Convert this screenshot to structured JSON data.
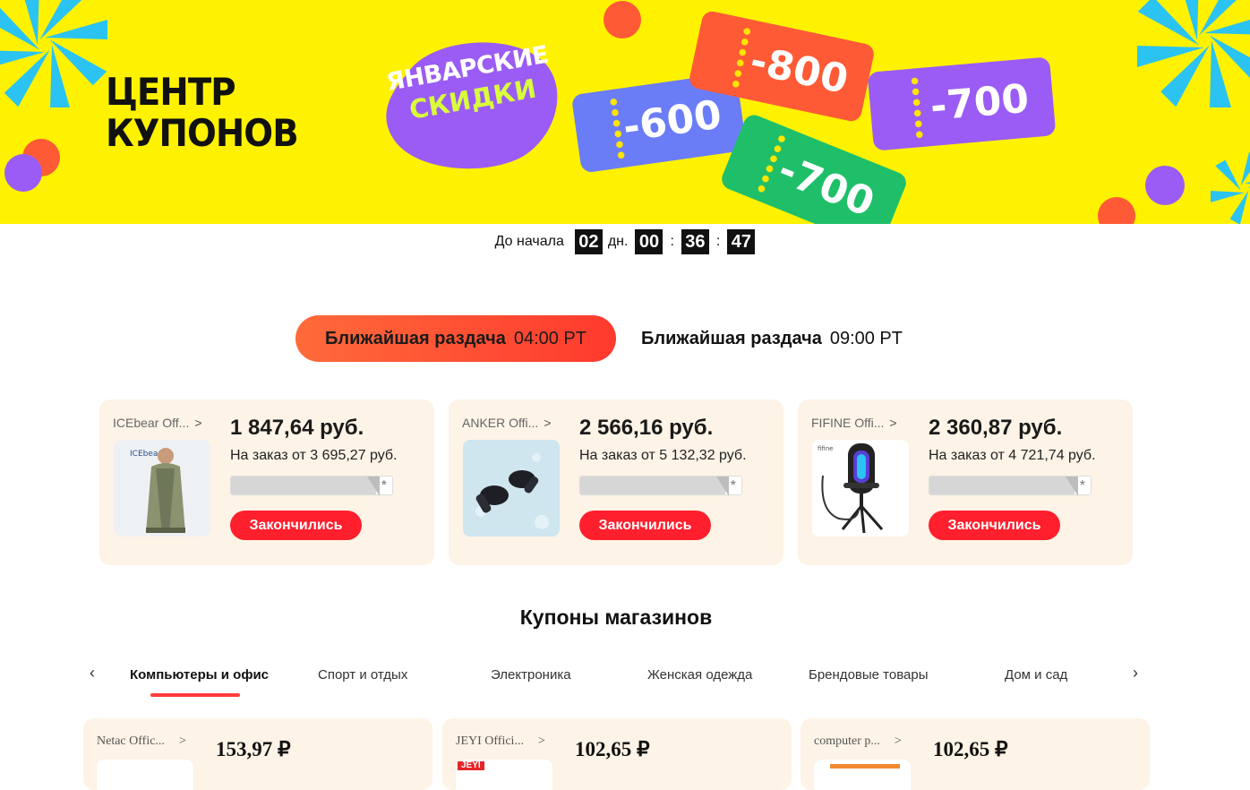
{
  "banner": {
    "title_line1": "ЦЕНТР",
    "title_line2": "КУПОНОВ",
    "promo_line1": "ЯНВАРСКИЕ",
    "promo_line2": "СКИДКИ",
    "tickets": [
      "-600",
      "-800",
      "-700",
      "-700"
    ],
    "colors": {
      "background": "#fff200",
      "orange": "#ff5a36",
      "blue": "#6b7cf7",
      "purple": "#9b5cf5",
      "green": "#1fbf6a",
      "cyan": "#2bc3f2"
    }
  },
  "countdown": {
    "label": "До начала",
    "days": "02",
    "days_unit": "дн.",
    "hours": "00",
    "minutes": "36",
    "seconds": "47",
    "separator": ":"
  },
  "schedule": [
    {
      "label": "Ближайшая раздача",
      "time": "04:00 PT",
      "active": true
    },
    {
      "label": "Ближайшая раздача",
      "time": "09:00 PT",
      "active": false
    }
  ],
  "deals": [
    {
      "store": "ICEbear Off...",
      "chevron": ">",
      "price": "1 847,64 руб.",
      "min_order": "На заказ от 3 695,27 руб.",
      "progress": 0.9,
      "star": "*",
      "button": "Закончились",
      "image": "coat-product-icon"
    },
    {
      "store": "ANKER Offi...",
      "chevron": ">",
      "price": "2 566,16 руб.",
      "min_order": "На заказ от 5 132,32 руб.",
      "progress": 0.9,
      "star": "*",
      "button": "Закончились",
      "image": "earbuds-product-icon"
    },
    {
      "store": "FIFINE Offi...",
      "chevron": ">",
      "price": "2 360,87 руб.",
      "min_order": "На заказ от 4 721,74 руб.",
      "progress": 0.9,
      "star": "*",
      "button": "Закончились",
      "image": "microphone-product-icon"
    }
  ],
  "store_coupons": {
    "title": "Купоны магазинов",
    "prev_arrow": "‹",
    "next_arrow": "›",
    "categories": [
      {
        "label": "Компьютеры и офис",
        "active": true
      },
      {
        "label": "Спорт и отдых",
        "active": false
      },
      {
        "label": "Электроника",
        "active": false
      },
      {
        "label": "Женская одежда",
        "active": false
      },
      {
        "label": "Брендовые товары",
        "active": false
      },
      {
        "label": "Дом и сад",
        "active": false
      }
    ],
    "cards": [
      {
        "store": "Netac Offic...",
        "chevron": ">",
        "price": "153,97 ₽"
      },
      {
        "store": "JEYI Offici...",
        "chevron": ">",
        "price": "102,65 ₽",
        "logo_text": "JEYI"
      },
      {
        "store": "computer p...",
        "chevron": ">",
        "price": "102,65 ₽"
      }
    ]
  }
}
